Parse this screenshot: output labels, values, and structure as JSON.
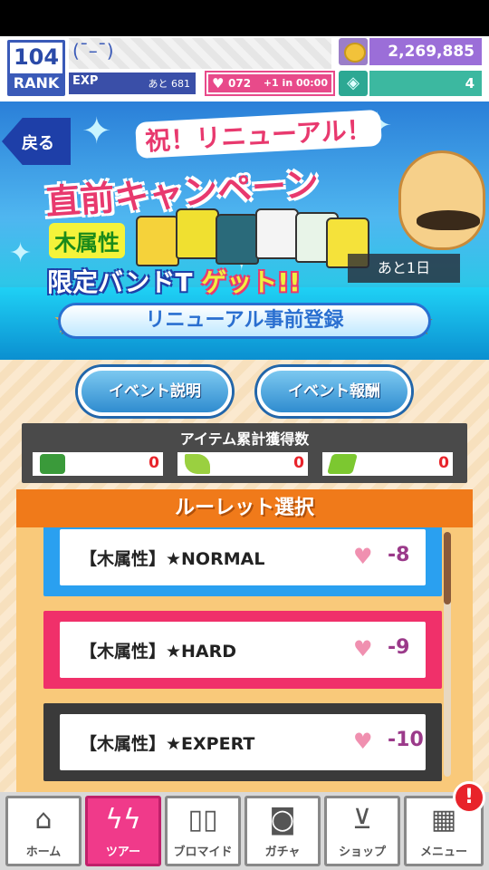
{
  "header": {
    "rank_number": "104",
    "rank_label": "RANK",
    "player_name": "(¯–¯)",
    "exp_label": "EXP",
    "exp_remaining": "あと 681",
    "stamina_icon": "heart-icon",
    "stamina_value": "072",
    "stamina_recovery": "+1 in 00:00",
    "coins": "2,269,885",
    "gems": "4",
    "coin_icon": "coin-icon",
    "gem_icon": "gem-icon"
  },
  "banner": {
    "back_label": "戻る",
    "title_line1": "祝！リニューアル！",
    "title_line2": "直前キャンペーン",
    "attribute": "木属性",
    "limited_text": "限定バンドT",
    "get_text": "ゲット!!",
    "remaining": "あと1日",
    "register_label": "リニューアル事前登録",
    "colors": {
      "accent": "#e8396e",
      "blue": "#2a6fd0"
    }
  },
  "buttons": {
    "event_description": "イベント説明",
    "event_rewards": "イベント報酬"
  },
  "items": {
    "title": "アイテム累計獲得数",
    "slots": [
      {
        "icon": "green-pedal-icon",
        "value": "0"
      },
      {
        "icon": "green-plane-icon",
        "value": "0"
      },
      {
        "icon": "green-ticket-icon",
        "value": "0"
      }
    ]
  },
  "roulette": {
    "title": "ルーレット選択",
    "options": [
      {
        "label": "【木属性】★NORMAL",
        "cost": "-8",
        "color": "#2aa0f0"
      },
      {
        "label": "【木属性】★HARD",
        "cost": "-9",
        "color": "#f0306a"
      },
      {
        "label": "【木属性】★EXPERT",
        "cost": "-10",
        "color": "#3a3a3a"
      }
    ]
  },
  "nav": {
    "items": [
      {
        "label": "ホーム",
        "icon": "home-icon"
      },
      {
        "label": "ツアー",
        "icon": "tour-icon"
      },
      {
        "label": "ブロマイド",
        "icon": "bromide-icon"
      },
      {
        "label": "ガチャ",
        "icon": "camera-icon"
      },
      {
        "label": "ショップ",
        "icon": "cart-icon"
      },
      {
        "label": "メニュー",
        "icon": "grid-icon"
      }
    ],
    "alert": "!"
  }
}
